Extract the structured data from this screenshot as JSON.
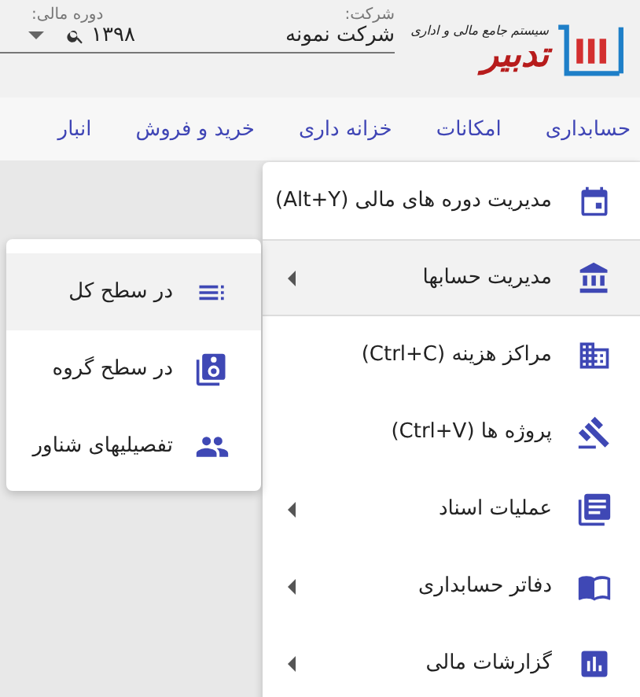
{
  "logo": {
    "tagline": "سیستم جامع مالی و اداری",
    "name": "تدبیر"
  },
  "company": {
    "label": "شرکت:",
    "value": "شرکت نمونه"
  },
  "period": {
    "label": "دوره مالی:",
    "value": "۱۳۹۸"
  },
  "nav": [
    {
      "label": "حسابداری"
    },
    {
      "label": "امکانات"
    },
    {
      "label": "خزانه داری"
    },
    {
      "label": "خرید و فروش"
    },
    {
      "label": "انبار"
    }
  ],
  "menu": [
    {
      "label": "مدیریت دوره های مالی (Alt+Y)",
      "has_submenu": false,
      "selected": false
    },
    {
      "label": "مدیریت حسابها",
      "has_submenu": true,
      "selected": true
    },
    {
      "label": "مراکز هزینه (Ctrl+C)",
      "has_submenu": false,
      "selected": false
    },
    {
      "label": "پروژه ها (Ctrl+V)",
      "has_submenu": false,
      "selected": false
    },
    {
      "label": "عملیات اسناد",
      "has_submenu": true,
      "selected": false
    },
    {
      "label": "دفاتر حسابداری",
      "has_submenu": true,
      "selected": false
    },
    {
      "label": "گزارشات مالی",
      "has_submenu": true,
      "selected": false
    }
  ],
  "submenu": [
    {
      "label": "در سطح کل",
      "selected": true
    },
    {
      "label": "در سطح گروه",
      "selected": false
    },
    {
      "label": "تفصیلیهای شناور",
      "selected": false
    }
  ]
}
